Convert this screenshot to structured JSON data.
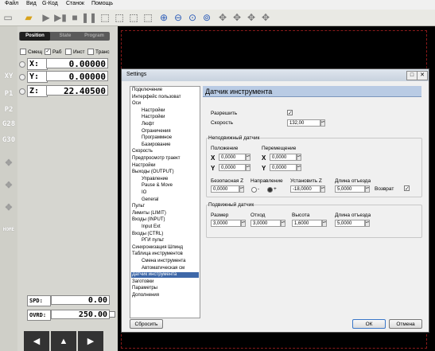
{
  "menu": [
    "Файл",
    "Вид",
    "G-Код",
    "Станок",
    "Помощь"
  ],
  "left": {
    "tabs": [
      "Position",
      "State",
      "Program"
    ],
    "checkboxes": [
      {
        "label": "Смещ",
        "checked": false
      },
      {
        "label": "Раб",
        "checked": true
      },
      {
        "label": "Инст",
        "checked": false
      },
      {
        "label": "Транс",
        "checked": false
      }
    ],
    "axes": [
      {
        "label": "X:",
        "value": "0.00000"
      },
      {
        "label": "Y:",
        "value": "0.00000"
      },
      {
        "label": "Z:",
        "value": "22.40500"
      }
    ],
    "spd": {
      "label": "SPD:",
      "value": "0.00"
    },
    "ovrd": {
      "label": "OVRD:",
      "value": "250.00"
    },
    "side_icons": [
      "XY",
      "P1",
      "P2",
      "G28",
      "G30",
      "HOME"
    ]
  },
  "dialog": {
    "title": "Settings",
    "tree": [
      {
        "label": "Подключение",
        "level": 0
      },
      {
        "label": "Интерфейс пользоват",
        "level": 0
      },
      {
        "label": "Оси",
        "level": 0
      },
      {
        "label": "Настройки",
        "level": 1
      },
      {
        "label": "Настройки",
        "level": 1
      },
      {
        "label": "Люфт",
        "level": 1
      },
      {
        "label": "Ограничения",
        "level": 1
      },
      {
        "label": "Программное",
        "level": 1
      },
      {
        "label": "Базирование",
        "level": 1
      },
      {
        "label": "Скорость",
        "level": 0
      },
      {
        "label": "Предпросмотр траект",
        "level": 0
      },
      {
        "label": "Настройки",
        "level": 0
      },
      {
        "label": "Выходы (OUTPUT)",
        "level": 0
      },
      {
        "label": "Управление",
        "level": 1
      },
      {
        "label": "Pause & Move",
        "level": 1
      },
      {
        "label": "IO",
        "level": 1
      },
      {
        "label": "General",
        "level": 1
      },
      {
        "label": "Пульт",
        "level": 0
      },
      {
        "label": "Лимиты (LIMIT)",
        "level": 0
      },
      {
        "label": "Входы (INPUT)",
        "level": 0
      },
      {
        "label": "Input Ext",
        "level": 1
      },
      {
        "label": "Входы (CTRL)",
        "level": 0
      },
      {
        "label": "РГИ пульт",
        "level": 1
      },
      {
        "label": "Синхронизация Шпинд",
        "level": 0
      },
      {
        "label": "Таблица инструментов",
        "level": 0
      },
      {
        "label": "Смена инструмента",
        "level": 1
      },
      {
        "label": "Автоматическая см",
        "level": 1
      },
      {
        "label": "Датчик инструмента",
        "level": 0,
        "selected": true
      },
      {
        "label": "Заготовки",
        "level": 0
      },
      {
        "label": "Параметры",
        "level": 0
      },
      {
        "label": "Дополнения",
        "level": 0
      }
    ],
    "header": "Датчик инструмента",
    "enable_label": "Разрешить",
    "enable_checked": true,
    "speed_label": "Скорость",
    "speed_value": "132,00",
    "fixed_group_title": "Неподвижный датчик",
    "position_label": "Положение",
    "move_label": "Перемещение",
    "pos_x": "0,0000",
    "pos_y": "0,0000",
    "move_x": "0,0000",
    "move_y": "0,0000",
    "x_label": "X",
    "y_label": "Y",
    "safe_z_label": "Безопасная Z",
    "safe_z_value": "0,0000",
    "direction_label": "Направление",
    "dir_minus": "-",
    "dir_plus": "+",
    "set_z_label": "Установить Z",
    "set_z_value": "-18,0000",
    "retract_label": "Длина отъезда",
    "retract_value": "5,0000",
    "return_label": "Возврат",
    "return_checked": true,
    "movable_group_title": "Подвижный датчик",
    "size_label": "Размер",
    "size_value": "3,0000",
    "offset_label": "Отход",
    "offset_value": "3,0000",
    "height_label": "Высота",
    "height_value": "1,6000",
    "retract2_label": "Длина отъезда",
    "retract2_value": "5,0000",
    "reset_button": "Сбросить",
    "ok_button": "ОК",
    "cancel_button": "Отмена"
  }
}
